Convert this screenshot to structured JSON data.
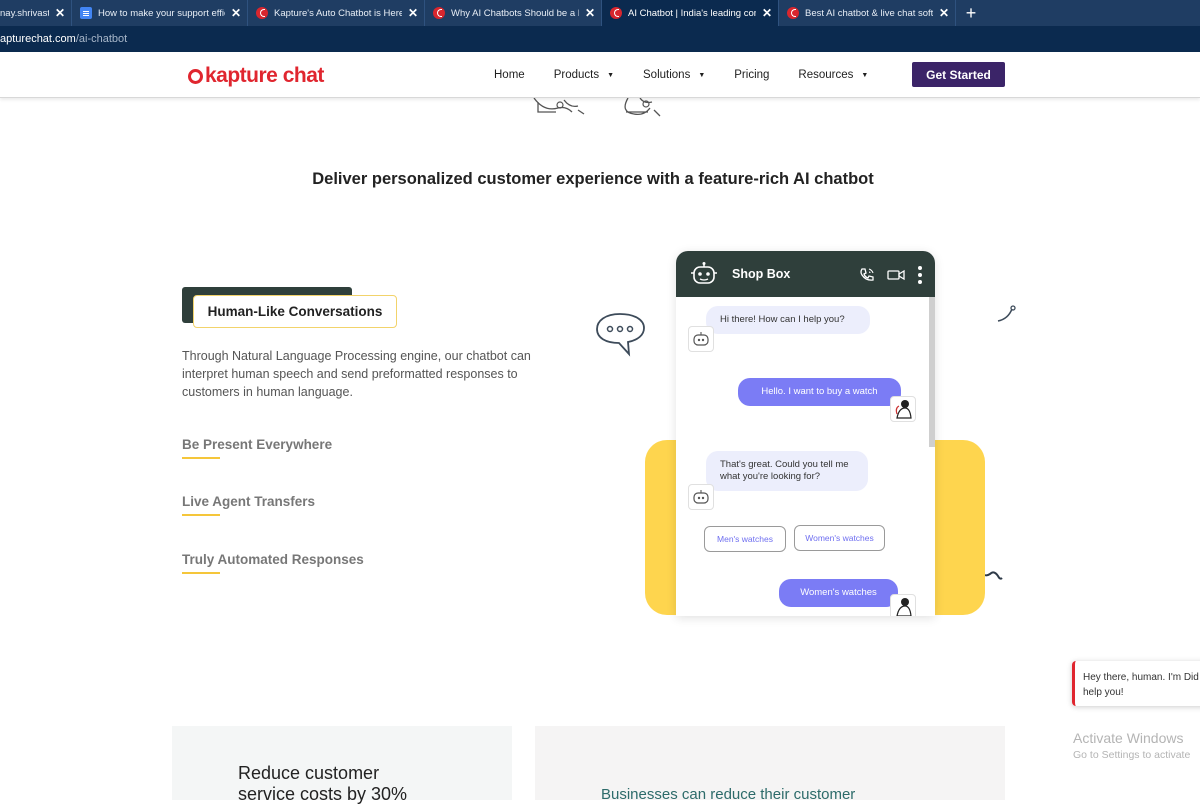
{
  "browser": {
    "tabs": [
      {
        "title": "nay.shrivasta",
        "icon": "generic",
        "active": false
      },
      {
        "title": "How to make your support effici",
        "icon": "doc",
        "active": false
      },
      {
        "title": "Kapture's Auto Chatbot is Here t",
        "icon": "kapture",
        "active": false
      },
      {
        "title": "Why AI Chatbots Should be a Par",
        "icon": "kapture",
        "active": false
      },
      {
        "title": "AI Chatbot | India's leading conv",
        "icon": "kapture",
        "active": true
      },
      {
        "title": "Best AI chatbot & live chat softw",
        "icon": "kapture",
        "active": false
      }
    ],
    "close_glyph": "✕",
    "new_tab_glyph": "+",
    "url_host": "apturechat.com",
    "url_path": "/ai-chatbot"
  },
  "header": {
    "logo_text": "kapture chat",
    "nav": [
      {
        "label": "Home",
        "dropdown": false
      },
      {
        "label": "Products",
        "dropdown": true
      },
      {
        "label": "Solutions",
        "dropdown": true
      },
      {
        "label": "Pricing",
        "dropdown": false
      },
      {
        "label": "Resources",
        "dropdown": true
      }
    ],
    "caret": "▼",
    "cta": "Get Started"
  },
  "main": {
    "heading": "Deliver personalized customer experience with a feature-rich AI chatbot",
    "features": {
      "active_title": "Human-Like Conversations",
      "active_desc": "Through Natural Language Processing engine, our chatbot can interpret human speech and send preformatted responses to customers in human language.",
      "others": [
        "Be Present Everywhere",
        "Live Agent Transfers",
        "Truly Automated Responses"
      ]
    },
    "chat": {
      "title": "Shop Box",
      "messages": [
        {
          "from": "bot",
          "text": "Hi there! How can I help you?"
        },
        {
          "from": "user",
          "text": "Hello. I want to buy a watch"
        },
        {
          "from": "bot",
          "text": "That's great. Could you tell me what you're looking for?"
        },
        {
          "from": "user",
          "text": "Women's watches"
        }
      ],
      "options": [
        "Men's watches",
        "Women's watches"
      ]
    },
    "bottom": {
      "left_title": "Reduce customer service costs by 30%",
      "right_title": "Businesses can reduce their customer"
    }
  },
  "widget": {
    "message": "Hey there, human. I'm Did help you!"
  },
  "os": {
    "watermark_line1": "Activate Windows",
    "watermark_line2": "Go to Settings to activate"
  },
  "colors": {
    "brand_red": "#e0262f",
    "cta_purple": "#3b2468",
    "chat_header": "#2f3f3b",
    "user_bubble": "#7b7cf5",
    "accent_yellow": "#fed54e"
  }
}
